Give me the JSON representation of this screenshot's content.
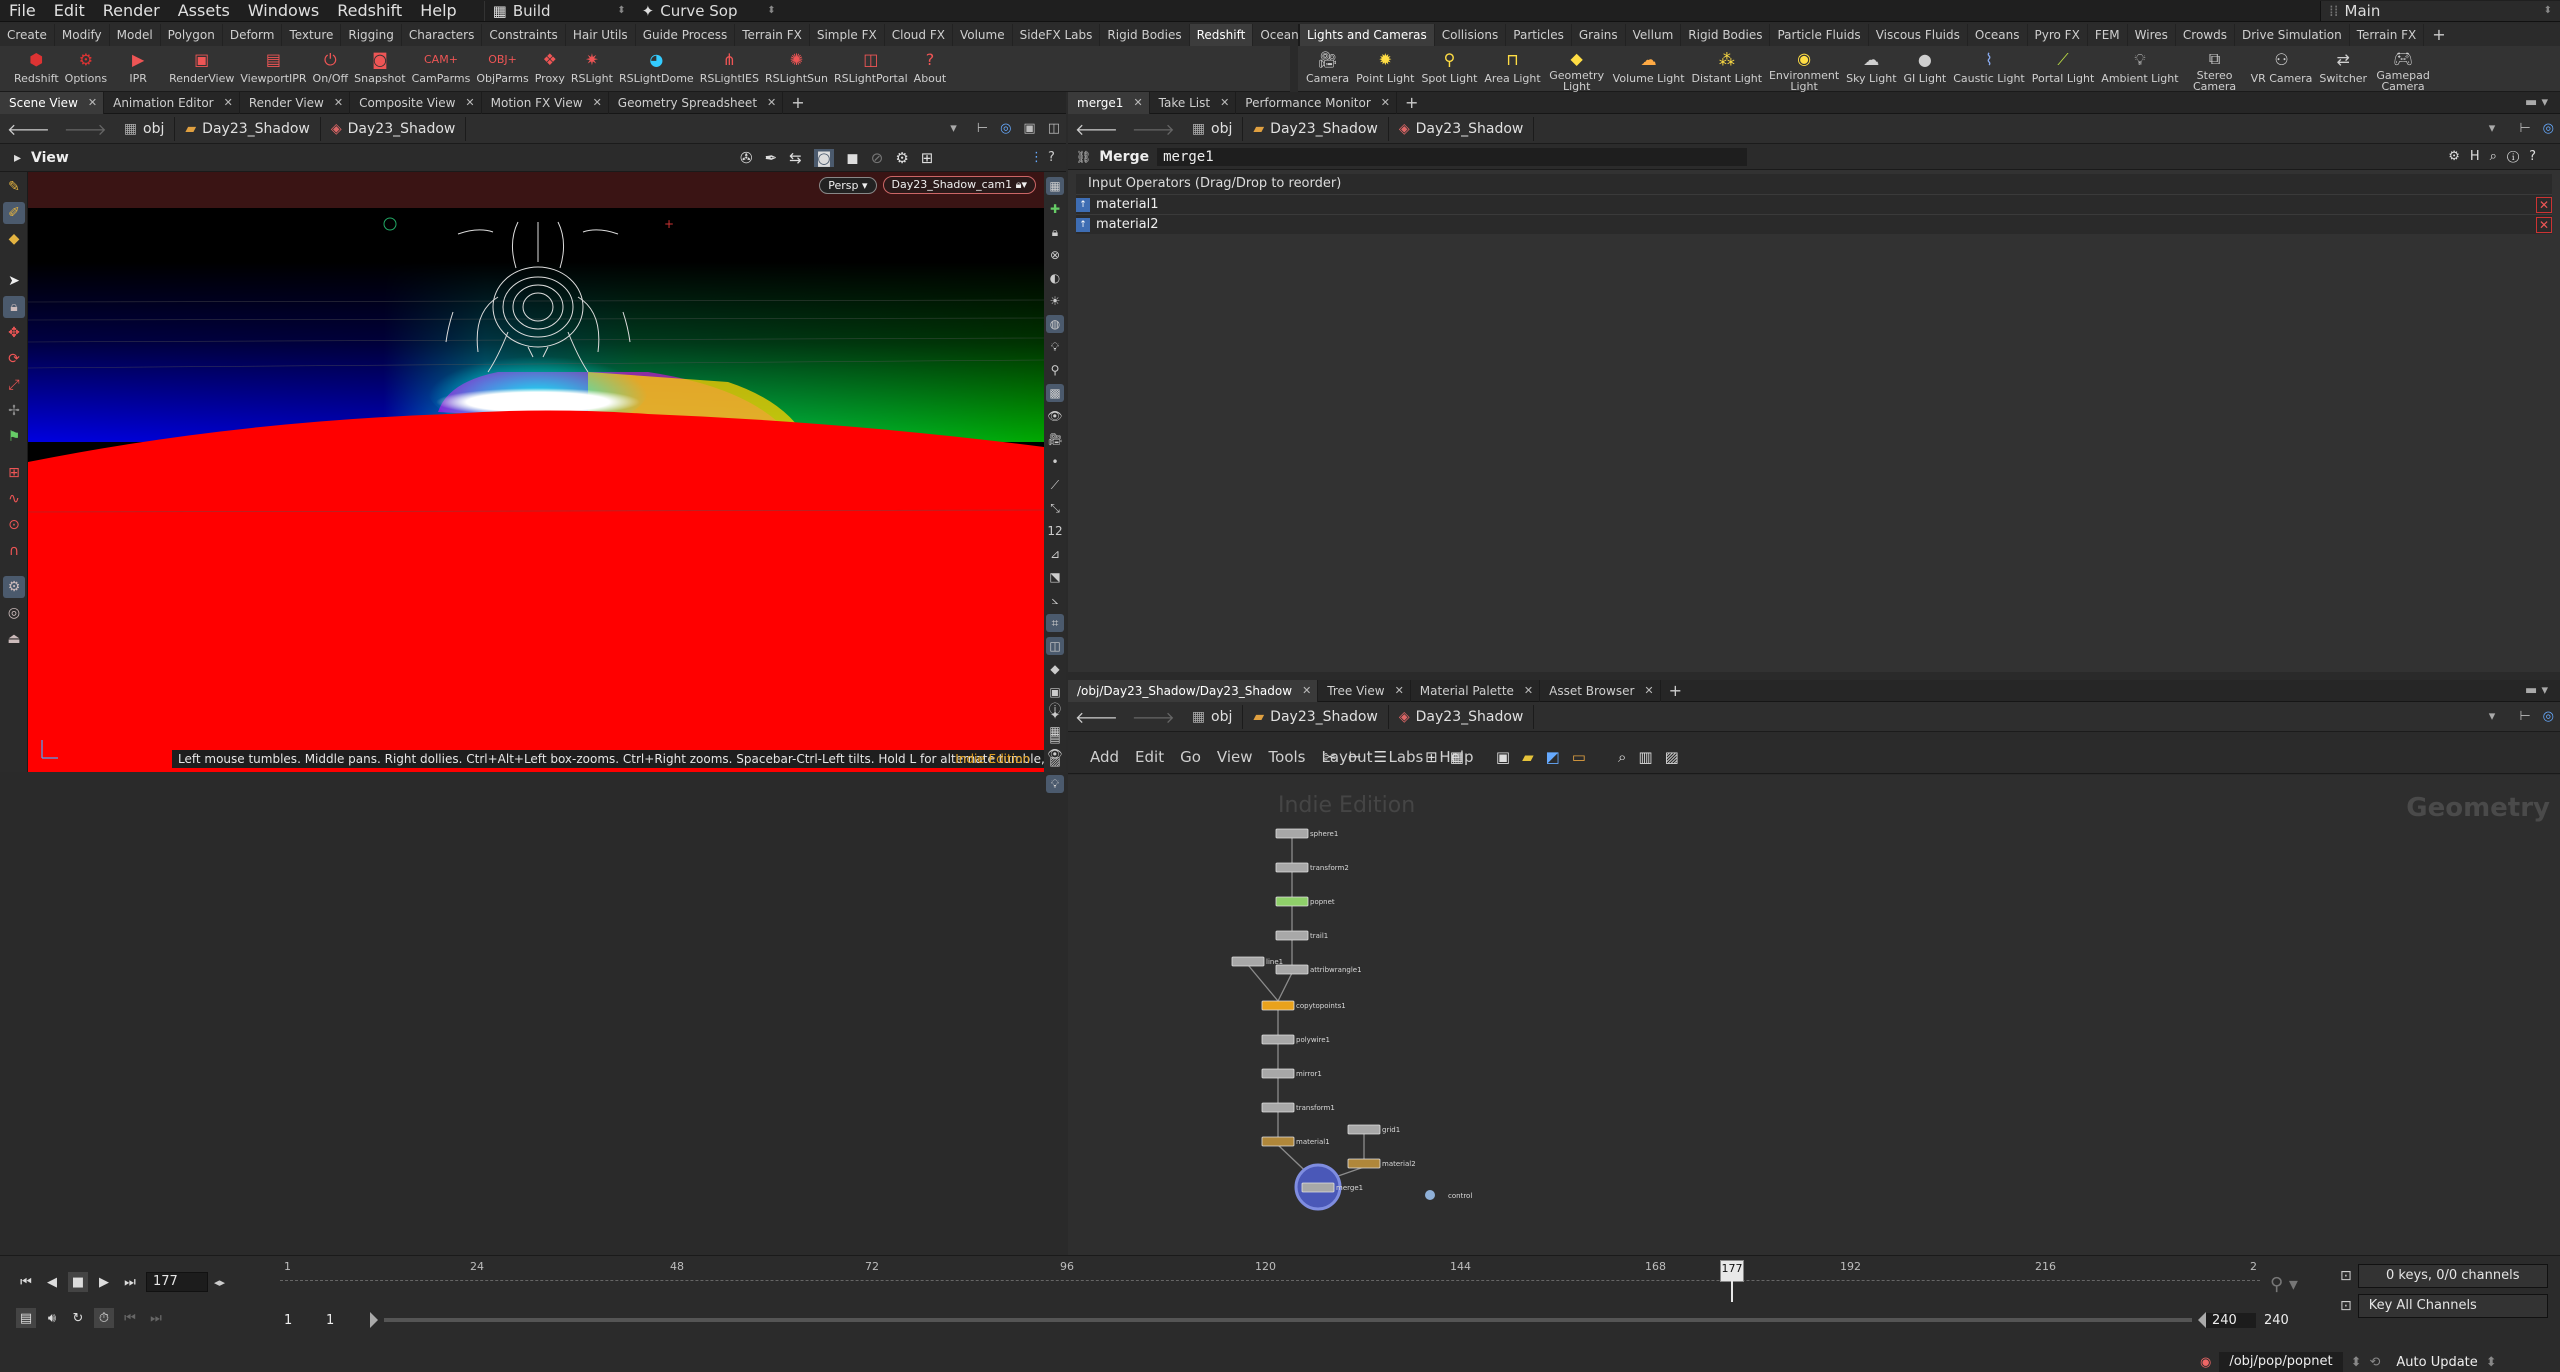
{
  "menubar": {
    "items": [
      "File",
      "Edit",
      "Render",
      "Assets",
      "Windows",
      "Redshift",
      "Help"
    ],
    "desktop": "Build",
    "context": "Curve Sop",
    "main": "Main"
  },
  "shelf_left": {
    "tabs": [
      "Create",
      "Modify",
      "Model",
      "Polygon",
      "Deform",
      "Texture",
      "Rigging",
      "Characters",
      "Constraints",
      "Hair Utils",
      "Guide Process",
      "Terrain FX",
      "Simple FX",
      "Cloud FX",
      "Volume",
      "SideFX Labs",
      "Rigid Bodies",
      "Redshift",
      "Oceans"
    ],
    "active": "Redshift",
    "tools": [
      "Redshift",
      "Options",
      "IPR",
      "RenderView",
      "ViewportIPR",
      "On/Off",
      "Snapshot",
      "CamParms",
      "ObjParms",
      "Proxy",
      "RSLight",
      "RSLightDome",
      "RSLightIES",
      "RSLightSun",
      "RSLightPortal",
      "About"
    ]
  },
  "shelf_right": {
    "tabs": [
      "Lights and Cameras",
      "Collisions",
      "Particles",
      "Grains",
      "Vellum",
      "Rigid Bodies",
      "Particle Fluids",
      "Viscous Fluids",
      "Oceans",
      "Pyro FX",
      "FEM",
      "Wires",
      "Crowds",
      "Drive Simulation",
      "Terrain FX"
    ],
    "tools": [
      "Camera",
      "Point Light",
      "Spot Light",
      "Area Light",
      "Geometry Light",
      "Volume Light",
      "Distant Light",
      "Environment Light",
      "Sky Light",
      "GI Light",
      "Caustic Light",
      "Portal Light",
      "Ambient Light",
      "Stereo Camera",
      "VR Camera",
      "Switcher",
      "Gamepad Camera"
    ]
  },
  "viewer": {
    "tabs": [
      "Scene View",
      "Animation Editor",
      "Render View",
      "Composite View",
      "Motion FX View",
      "Geometry Spreadsheet"
    ],
    "path": [
      "obj",
      "Day23_Shadow",
      "Day23_Shadow"
    ],
    "title": "View",
    "persp": "Persp",
    "camera": "Day23_Shadow_cam1",
    "hint": "Left mouse tumbles. Middle pans. Right dollies. Ctrl+Alt+Left box-zooms. Ctrl+Right zooms. Spacebar-Ctrl-Left tilts. Hold L for alternate tumble, dolly, and zoom.    M or Alt+M for First Person Navigation.",
    "edition": "Indie Edition"
  },
  "parm": {
    "tabs": [
      "merge1",
      "Take List",
      "Performance Monitor"
    ],
    "path": [
      "obj",
      "Day23_Shadow",
      "Day23_Shadow"
    ],
    "node_type": "Merge",
    "node_name": "merge1",
    "section": "Input Operators (Drag/Drop to reorder)",
    "inputs": [
      "material1",
      "material2"
    ]
  },
  "network": {
    "tabs": [
      "/obj/Day23_Shadow/Day23_Shadow",
      "Tree View",
      "Material Palette",
      "Asset Browser"
    ],
    "path": [
      "obj",
      "Day23_Shadow",
      "Day23_Shadow"
    ],
    "menus": [
      "Add",
      "Edit",
      "Go",
      "View",
      "Tools",
      "Layout",
      "Labs",
      "Help"
    ],
    "watermark": "Indie Edition",
    "context": "Geometry",
    "nodes": [
      "sphere1",
      "transform2",
      "popnet",
      "trail1",
      "attribwrangle1",
      "line1",
      "copytopoints1",
      "polywire1",
      "mirror1",
      "transform1",
      "material1",
      "grid1",
      "material2",
      "merge1",
      "control"
    ]
  },
  "timeline": {
    "frame": "177",
    "ticks": [
      "1",
      "24",
      "48",
      "72",
      "96",
      "120",
      "144",
      "168",
      "192",
      "216",
      "2"
    ],
    "current_marker": "177",
    "range_start": "1",
    "range_start2": "1",
    "range_end": "240",
    "range_end2": "240",
    "keys": "0 keys, 0/0 channels",
    "key_all": "Key All Channels",
    "status_path": "/obj/pop/popnet",
    "auto_update": "Auto Update"
  }
}
